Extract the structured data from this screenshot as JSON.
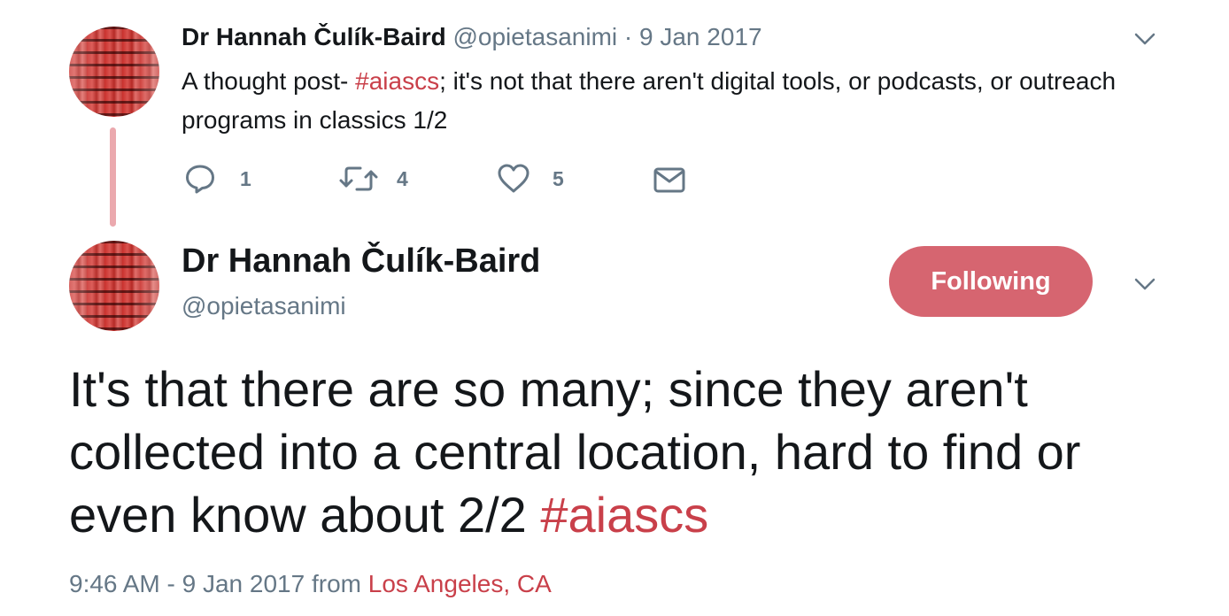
{
  "tweet1": {
    "author_name": "Dr Hannah Čulík-Baird",
    "handle": "@opietasanimi",
    "separator": "·",
    "date": "9 Jan 2017",
    "text_before": "A thought post- ",
    "hashtag": "#aiascs",
    "text_after": "; it's not that there aren't digital tools, or podcasts, or outreach programs in classics 1/2",
    "actions": {
      "reply_count": "1",
      "retweet_count": "4",
      "like_count": "5"
    }
  },
  "tweet2": {
    "author_name": "Dr Hannah Čulík-Baird",
    "handle": "@opietasanimi",
    "follow_label": "Following",
    "text_main": "It's that there are so many; since they aren't collected into a central location, hard to find or even know about 2/2 ",
    "hashtag": "#aiascs",
    "timestamp": "9:46 AM - 9 Jan 2017",
    "from_label": " from ",
    "location": "Los Angeles, CA"
  },
  "colors": {
    "accent": "#c9404a",
    "follow_button": "#d66570",
    "thread_line": "#eba9ae",
    "muted_text": "#657786"
  }
}
